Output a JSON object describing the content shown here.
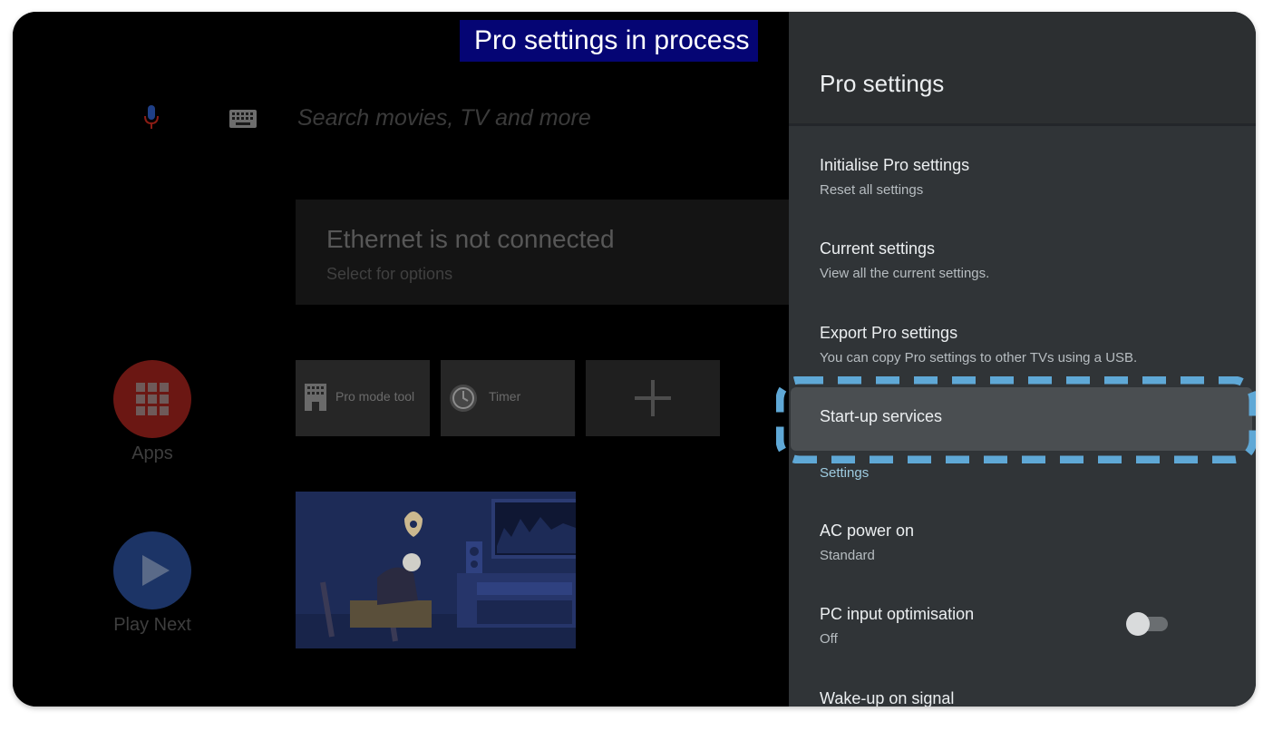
{
  "caption": "Pro settings in process",
  "home": {
    "search_placeholder": "Search movies, TV and more",
    "network_card": {
      "title": "Ethernet is not connected",
      "subtitle": "Select for options"
    },
    "apps_label": "Apps",
    "play_next_label": "Play Next",
    "tiles": {
      "pro_mode_tool": "Pro mode tool",
      "timer": "Timer"
    }
  },
  "panel": {
    "title": "Pro settings",
    "items": [
      {
        "title": "Initialise Pro settings",
        "subtitle": "Reset all settings"
      },
      {
        "title": "Current settings",
        "subtitle": "View all the current settings."
      },
      {
        "title": "Export Pro settings",
        "subtitle": "You can copy Pro settings to other TVs using a USB."
      },
      {
        "title": "Start-up services",
        "selected": true
      }
    ],
    "section_header": "Settings",
    "settings_items": [
      {
        "title": "AC power on",
        "subtitle": "Standard"
      },
      {
        "title": "PC input optimisation",
        "subtitle": "Off",
        "toggle": "off"
      },
      {
        "title": "Wake-up on signal"
      }
    ]
  },
  "colors": {
    "panel_bg": "#303437",
    "selected_bg": "#4a4e51",
    "highlight_outline": "#5fa8d6",
    "section_header": "#9ecbe0",
    "caption_bg": "#050574",
    "apps_bg": "#6b1713",
    "play_next_bg": "#1c3466"
  },
  "icons": [
    "microphone-icon",
    "keyboard-icon",
    "apps-grid-icon",
    "play-icon",
    "pro-mode-tool-icon",
    "timer-icon",
    "add-icon",
    "toggle-switch"
  ]
}
